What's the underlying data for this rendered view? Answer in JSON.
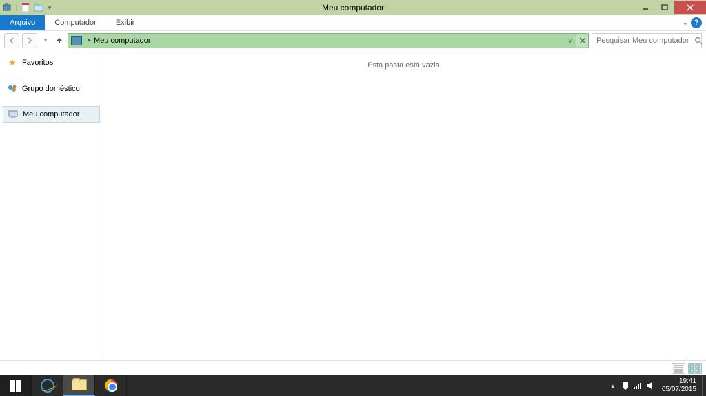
{
  "window": {
    "title": "Meu computador"
  },
  "ribbon": {
    "tabs": {
      "file": "Arquivo",
      "computer": "Computador",
      "view": "Exibir"
    }
  },
  "nav": {
    "breadcrumb": "Meu computador",
    "search_placeholder": "Pesquisar Meu computador"
  },
  "sidebar": {
    "favorites": "Favoritos",
    "homegroup": "Grupo doméstico",
    "computer": "Meu computador"
  },
  "content": {
    "empty_message": "Esta pasta está vazia."
  },
  "taskbar": {
    "time": "19:41",
    "date": "05/07/2015"
  }
}
